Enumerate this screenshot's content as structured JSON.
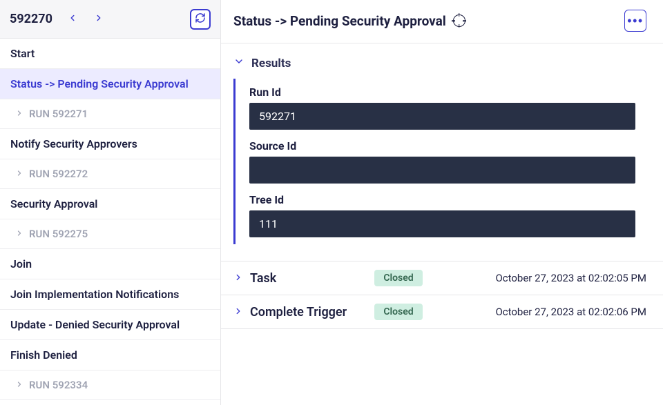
{
  "sidebar": {
    "title": "592270",
    "items": [
      {
        "type": "step",
        "label": "Start",
        "selected": false
      },
      {
        "type": "step",
        "label": "Status -> Pending Security Approval",
        "selected": true
      },
      {
        "type": "run",
        "label": "RUN 592271"
      },
      {
        "type": "step",
        "label": "Notify Security Approvers",
        "selected": false
      },
      {
        "type": "run",
        "label": "RUN 592272"
      },
      {
        "type": "step",
        "label": "Security Approval",
        "selected": false
      },
      {
        "type": "run",
        "label": "RUN 592275"
      },
      {
        "type": "step",
        "label": "Join",
        "selected": false
      },
      {
        "type": "step",
        "label": "Join Implementation Notifications",
        "selected": false
      },
      {
        "type": "step",
        "label": "Update - Denied Security Approval",
        "selected": false
      },
      {
        "type": "step",
        "label": "Finish Denied",
        "selected": false
      },
      {
        "type": "run",
        "label": "RUN 592334"
      }
    ]
  },
  "main": {
    "title": "Status -> Pending Security Approval",
    "results": {
      "heading": "Results",
      "fields": {
        "run_id": {
          "label": "Run Id",
          "value": "592271"
        },
        "source_id": {
          "label": "Source Id",
          "value": ""
        },
        "tree_id": {
          "label": "Tree Id",
          "value": "111"
        }
      }
    },
    "events": [
      {
        "label": "Task",
        "status": "Closed",
        "timestamp": "October 27, 2023 at 02:02:05 PM"
      },
      {
        "label": "Complete Trigger",
        "status": "Closed",
        "timestamp": "October 27, 2023 at 02:02:06 PM"
      }
    ]
  }
}
